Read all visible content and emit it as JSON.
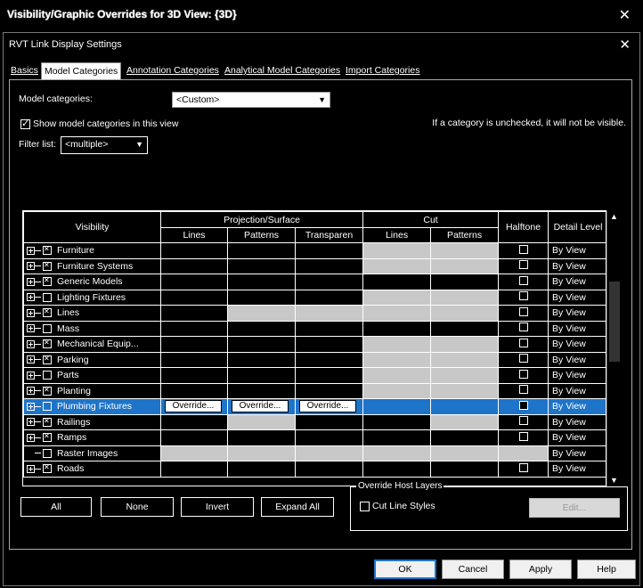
{
  "window": {
    "outer_title": "Visibility/Graphic Overrides for 3D View: {3D}",
    "dialog_title": "RVT Link Display Settings"
  },
  "tabs": [
    {
      "label": "Basics",
      "active": false
    },
    {
      "label": "Model Categories",
      "active": true
    },
    {
      "label": "Annotation Categories",
      "active": false
    },
    {
      "label": "Analytical Model Categories",
      "active": false
    },
    {
      "label": "Import Categories",
      "active": false
    }
  ],
  "model_categories": {
    "label": "Model categories:",
    "value": "<Custom>"
  },
  "show_model_categories": {
    "label": "Show model categories in this view",
    "checked": true
  },
  "hint": "If a category is unchecked, it will not be visible.",
  "filter_list": {
    "label": "Filter list:",
    "value": "<multiple>"
  },
  "table": {
    "headers": {
      "visibility": "Visibility",
      "projection_surface": "Projection/Surface",
      "cut": "Cut",
      "halftone": "Halftone",
      "detail_level": "Detail Level",
      "lines": "Lines",
      "patterns": "Patterns",
      "transparency": "Transparen",
      "cut_lines": "Lines",
      "cut_patterns": "Patterns"
    },
    "override_label": "Override...",
    "rows": [
      {
        "name": "Furniture",
        "expand": true,
        "checked": true,
        "detail": "By View"
      },
      {
        "name": "Furniture Systems",
        "expand": true,
        "checked": true,
        "detail": "By View"
      },
      {
        "name": "Generic Models",
        "expand": true,
        "checked": true,
        "detail": "By View"
      },
      {
        "name": "Lighting Fixtures",
        "expand": true,
        "checked": false,
        "detail": "By View"
      },
      {
        "name": "Lines",
        "expand": true,
        "checked": true,
        "detail": "By View"
      },
      {
        "name": "Mass",
        "expand": true,
        "checked": false,
        "detail": "By View"
      },
      {
        "name": "Mechanical Equip...",
        "expand": true,
        "checked": true,
        "detail": "By View"
      },
      {
        "name": "Parking",
        "expand": true,
        "checked": true,
        "detail": "By View"
      },
      {
        "name": "Parts",
        "expand": true,
        "checked": false,
        "detail": "By View"
      },
      {
        "name": "Planting",
        "expand": true,
        "checked": true,
        "detail": "By View"
      },
      {
        "name": "Plumbing Fixtures",
        "expand": true,
        "checked": false,
        "detail": "By View",
        "selected": true
      },
      {
        "name": "Railings",
        "expand": true,
        "checked": true,
        "detail": "By View"
      },
      {
        "name": "Ramps",
        "expand": true,
        "checked": true,
        "detail": "By View"
      },
      {
        "name": "Raster Images",
        "expand": false,
        "checked": false,
        "detail": "By View"
      },
      {
        "name": "Roads",
        "expand": true,
        "checked": true,
        "detail": "By View"
      }
    ]
  },
  "buttons": {
    "all": "All",
    "none": "None",
    "invert": "Invert",
    "expand_all": "Expand All",
    "edit": "Edit...",
    "ok": "OK",
    "cancel": "Cancel",
    "apply": "Apply",
    "help": "Help"
  },
  "override_host_layers": {
    "legend": "Override Host Layers",
    "cut_line_styles": "Cut Line Styles",
    "checked": false
  },
  "colors": {
    "selection": "#1e74c8",
    "gray_cell": "#c8c8c8"
  }
}
